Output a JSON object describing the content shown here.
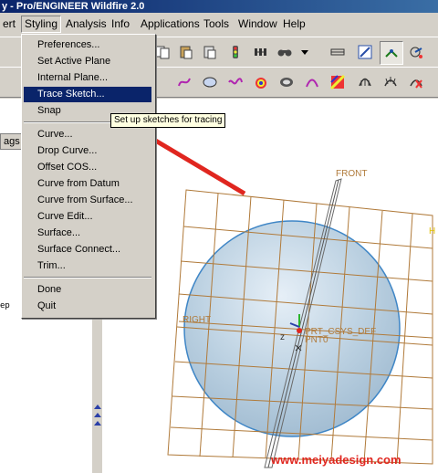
{
  "window": {
    "title": "y - Pro/ENGINEER Wildfire 2.0"
  },
  "menubar": {
    "items": [
      {
        "label": "ert"
      },
      {
        "label": "Styling"
      },
      {
        "label": "Analysis"
      },
      {
        "label": "Info"
      },
      {
        "label": "Applications"
      },
      {
        "label": "Tools"
      },
      {
        "label": "Window"
      },
      {
        "label": "Help"
      }
    ]
  },
  "styling_menu": {
    "items": [
      {
        "label": "Preferences..."
      },
      {
        "label": "Set Active Plane"
      },
      {
        "label": "Internal Plane..."
      },
      {
        "label": "Trace Sketch..."
      },
      {
        "label": "Snap"
      },
      {
        "label": "Curve..."
      },
      {
        "label": "Drop Curve..."
      },
      {
        "label": "Offset COS..."
      },
      {
        "label": "Curve from Datum"
      },
      {
        "label": "Curve from Surface..."
      },
      {
        "label": "Curve Edit..."
      },
      {
        "label": "Surface..."
      },
      {
        "label": "Surface Connect..."
      },
      {
        "label": "Trim..."
      },
      {
        "label": "Done"
      },
      {
        "label": "Quit"
      }
    ],
    "highlighted": "Trace Sketch..."
  },
  "tooltip": {
    "text": "Set up sketches for tracing"
  },
  "left_panel": {
    "tab_label": "ags",
    "lines": [
      "",
      "ep"
    ]
  },
  "viewport": {
    "labels": {
      "front": "FRONT",
      "right": "RIGHT",
      "top": "H",
      "csys": "PRT_CSYS_DEF",
      "pnt": "PNT0",
      "axis": "z"
    }
  },
  "watermark": {
    "text": "www.meiyadesign.com"
  },
  "colors": {
    "sphere": "#b9cfe0",
    "sphere_edge": "#3f86c6",
    "datum_plane": "#b07a3a",
    "arrow": "#e0261f",
    "highlight": "#0a246a"
  }
}
